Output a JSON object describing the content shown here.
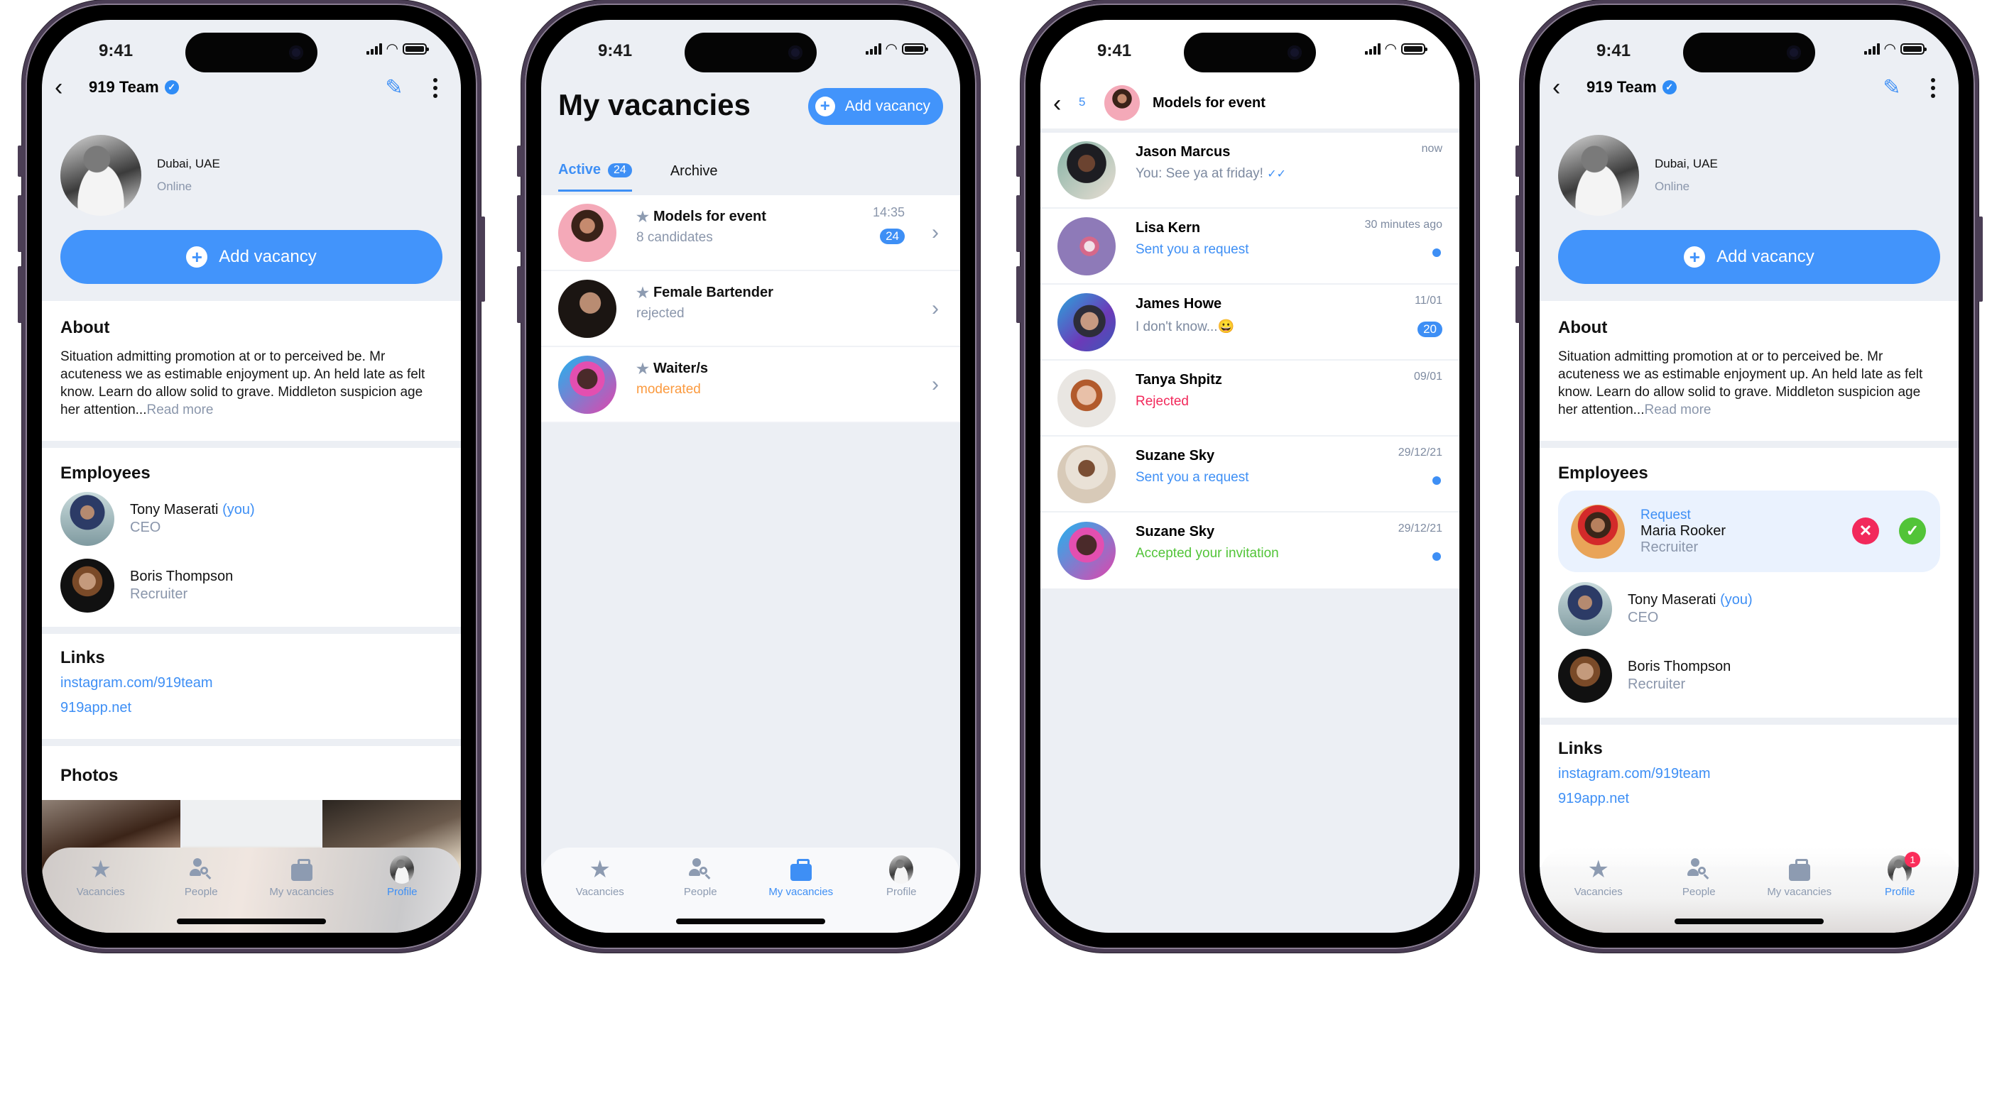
{
  "status_bar": {
    "time": "9:41"
  },
  "profile": {
    "title": "919 Team",
    "location": "Dubai, UAE",
    "presence": "Online",
    "add_vacancy": "Add vacancy",
    "about": {
      "heading": "About",
      "text": "Situation admitting promotion at or to perceived be. Mr acuteness we as estimable enjoyment up. An held late as felt know. Learn do allow solid to grave. Middleton suspicion age her attention...",
      "read_more": "Read more"
    },
    "employees": {
      "heading": "Employees",
      "items": [
        {
          "name": "Tony Maserati",
          "you_tag": "(you)",
          "role": "CEO"
        },
        {
          "name": "Boris Thompson",
          "you_tag": "",
          "role": "Recruiter"
        }
      ],
      "request": {
        "label": "Request",
        "name": "Maria Rooker",
        "role": "Recruiter"
      }
    },
    "links": {
      "heading": "Links",
      "items": [
        "instagram.com/919team",
        "919app.net"
      ]
    },
    "photos": {
      "heading": "Photos"
    }
  },
  "tabbar": {
    "items": [
      {
        "label": "Vacancies",
        "icon": "star-icon"
      },
      {
        "label": "People",
        "icon": "people-search-icon"
      },
      {
        "label": "My vacancies",
        "icon": "briefcase-icon"
      },
      {
        "label": "Profile",
        "icon": "profile-avatar"
      }
    ],
    "profile_badge": "1"
  },
  "vacancies": {
    "title": "My vacancies",
    "add_button": "Add vacancy",
    "tabs": [
      {
        "label": "Active",
        "count": "24"
      },
      {
        "label": "Archive"
      }
    ],
    "items": [
      {
        "title": "Models for event",
        "subtitle": "8 candidates",
        "time": "14:35",
        "count": "24",
        "status": "normal"
      },
      {
        "title": "Female Bartender",
        "subtitle": "rejected",
        "time": "",
        "count": "",
        "status": "normal"
      },
      {
        "title": "Waiter/s",
        "subtitle": "moderated",
        "time": "",
        "count": "",
        "status": "moderated"
      }
    ]
  },
  "chat": {
    "back_count": "5",
    "title": "Models for event",
    "items": [
      {
        "name": "Jason Marcus",
        "message": "You: See ya at friday!",
        "time": "now",
        "tone": "grey",
        "read": "✓✓"
      },
      {
        "name": "Lisa Kern",
        "message": "Sent you a request",
        "time": "30 minutes ago",
        "tone": "blue",
        "unread_dot": true
      },
      {
        "name": "James Howe",
        "message": "I don't know...😀",
        "time": "11/01",
        "tone": "grey",
        "count": "20"
      },
      {
        "name": "Tanya Shpitz",
        "message": "Rejected",
        "time": "09/01",
        "tone": "red"
      },
      {
        "name": "Suzane Sky",
        "message": "Sent you a request",
        "time": "29/12/21",
        "tone": "blue",
        "unread_dot": true
      },
      {
        "name": "Suzane Sky",
        "message": "Accepted your invitation",
        "time": "29/12/21",
        "tone": "green",
        "unread_dot": true
      }
    ]
  },
  "colors": {
    "accent": "#4294fb",
    "link": "#3e8ff5",
    "muted": "#8a96ab",
    "danger": "#f2295b",
    "success": "#52c438",
    "warning": "#fb9a3f",
    "background": "#eceff4"
  }
}
